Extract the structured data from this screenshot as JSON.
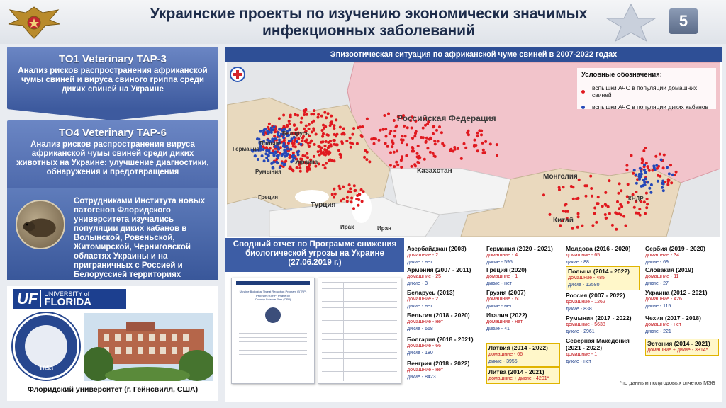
{
  "header": {
    "title_line1": "Украинские проекты по изучению экономически значимых",
    "title_line2": "инфекционных заболеваний",
    "page_number": "5"
  },
  "left": {
    "project1": {
      "name": "TO1 Veterinary TAP-3",
      "description": "Анализ рисков распространения африканской чумы свиней и вируса свиного гриппа среди диких свиней на Украине"
    },
    "project2": {
      "name": "TO4 Veterinary TAP-6",
      "description": "Анализ рисков распространения вируса африканской чумы свиней среди диких животных на Украине: улучшение диагностики, обнаружения и предотвращения"
    },
    "boar_text": "Сотрудниками Института новых патогенов Флоридского университета изучались популяции диких кабанов в Волынской, Ровеньской, Житомирской, Черниговской областях Украины и на приграничных с Россией и Белоруссией территориях",
    "uf_logo": {
      "mark": "UF",
      "line1": "UNIVERSITY of",
      "line2": "FLORIDA"
    },
    "seal_year": "1853",
    "caption": "Флоридский университет (г. Гейнсвилл, США)"
  },
  "map": {
    "title": "Эпизоотическая ситуация по африканской чуме свиней в 2007-2022 годах",
    "legend_title": "Условные обозначения:",
    "legend_domestic": "вспышки АЧС в популяции домашних свиней",
    "legend_wild": "вспышки АЧС в популяции диких кабанов",
    "labels": {
      "russia": "Российская Федерация",
      "kazakhstan": "Казахстан",
      "mongolia": "Монголия",
      "china": "Китай",
      "dprk": "КНДР",
      "turkey": "Турция",
      "iraq": "Ирак",
      "iran": "Иран",
      "greece": "Греция",
      "germany": "Германия",
      "poland": "Польша",
      "ukraine": "Украина",
      "romania": "Румыния",
      "belarus": "Беларусь"
    },
    "colors": {
      "domestic": "#e0191f",
      "wild": "#2448b8",
      "russia_fill": "#f2c4cb",
      "affected_fill": "#ead9be"
    }
  },
  "report": {
    "heading": "Сводный отчет по Программе снижения биологической угрозы на Украине (27.06.2019 г.)",
    "doc_title": "Ukraine Biological Threat Reduction Program (BTRP)",
    "doc_sub": "Program (BTRP) Phase IIb",
    "doc_plan": "Country Science Plan (CSP)"
  },
  "stats": {
    "domestic_label": "домашние",
    "wild_label": "дикие",
    "columns": [
      [
        {
          "name": "Азербайджан (2008)",
          "domestic": "домашние - 2",
          "wild": "дикие - нет"
        },
        {
          "name": "Армения (2007 - 2011)",
          "domestic": "домашние - 25",
          "wild": "дикие - 3"
        },
        {
          "name": "Беларусь (2013)",
          "domestic": "домашние - 2",
          "wild": "дикие - нет"
        },
        {
          "name": "Бельгия (2018 - 2020)",
          "domestic": "домашние - нет",
          "wild": "дикие - 668"
        },
        {
          "name": "Болгария (2018 - 2021)",
          "domestic": "домашние - 66",
          "wild": "дикие - 180"
        },
        {
          "name": "Венгрия (2018 - 2022)",
          "domestic": "домашние - нет",
          "wild": "дикие - 8423"
        }
      ],
      [
        {
          "name": "Германия (2020 - 2021)",
          "domestic": "домашние - 4",
          "wild": "дикие - 595"
        },
        {
          "name": "Греция (2020)",
          "domestic": "домашние - 1",
          "wild": "дикие - нет"
        },
        {
          "name": "Грузия (2007)",
          "domestic": "домашние - 60",
          "wild": "дикие - нет"
        },
        {
          "name": "Италия (2022)",
          "domestic": "домашние - нет",
          "wild": "дикие - 41"
        },
        {
          "name": "Латвия (2014 - 2022)",
          "domestic": "домашние - 66",
          "wild": "дикие - 3955",
          "highlight": true
        },
        {
          "name": "Литва (2014 - 2021)",
          "domestic": "домашние + дикие - 4201*",
          "wild": "",
          "highlight": true
        }
      ],
      [
        {
          "name": "Молдова (2016 - 2020)",
          "domestic": "домашние - 65",
          "wild": "дикие - 88"
        },
        {
          "name": "Польша (2014 - 2022)",
          "domestic": "домашние - 485",
          "wild": "дикие - 12580",
          "highlight": true
        },
        {
          "name": "Россия (2007 - 2022)",
          "domestic": "домашние - 1262",
          "wild": "дикие - 838"
        },
        {
          "name": "Румыния (2017 - 2022)",
          "domestic": "домашние - 5638",
          "wild": "дикие - 2961"
        },
        {
          "name": "Северная Македония (2021 - 2022)",
          "domestic": "домашние - 1",
          "wild": "дикие - нет"
        }
      ],
      [
        {
          "name": "Сербия (2019 - 2020)",
          "domestic": "домашние - 34",
          "wild": "дикие - 69"
        },
        {
          "name": "Словакия (2019)",
          "domestic": "домашние - 11",
          "wild": "дикие - 27"
        },
        {
          "name": "Украина (2012 - 2021)",
          "domestic": "домашние - 426",
          "wild": "дикие - 115"
        },
        {
          "name": "Чехия (2017 - 2018)",
          "domestic": "домашние - нет",
          "wild": "дикие - 221"
        },
        {
          "name": "Эстония (2014 - 2021)",
          "domestic": "домашние + дикие - 3814*",
          "wild": "",
          "highlight": true
        }
      ]
    ],
    "footnote": "*по данным полугодовых отчетов МЭБ"
  }
}
